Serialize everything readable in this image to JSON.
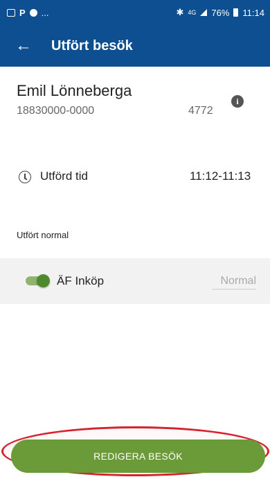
{
  "status_bar": {
    "left_ellipsis": "...",
    "network": "4G",
    "battery": "76%",
    "time": "11:14"
  },
  "app_bar": {
    "back_glyph": "←",
    "title": "Utfört besök"
  },
  "client": {
    "name": "Emil Lönneberga",
    "personal_number": "18830000-0000",
    "code": "4772",
    "info_glyph": "i"
  },
  "performed_time": {
    "label": "Utförd tid",
    "value": "11:12-11:13"
  },
  "section": {
    "label": "Utfört normal"
  },
  "tasks": [
    {
      "label": "ÄF Inköp",
      "value": "Normal",
      "enabled": true
    }
  ],
  "action": {
    "label": "REDIGERA BESÖK"
  },
  "colors": {
    "primary": "#0d4f91",
    "accent": "#6b9a38",
    "highlight": "#d8222e"
  }
}
